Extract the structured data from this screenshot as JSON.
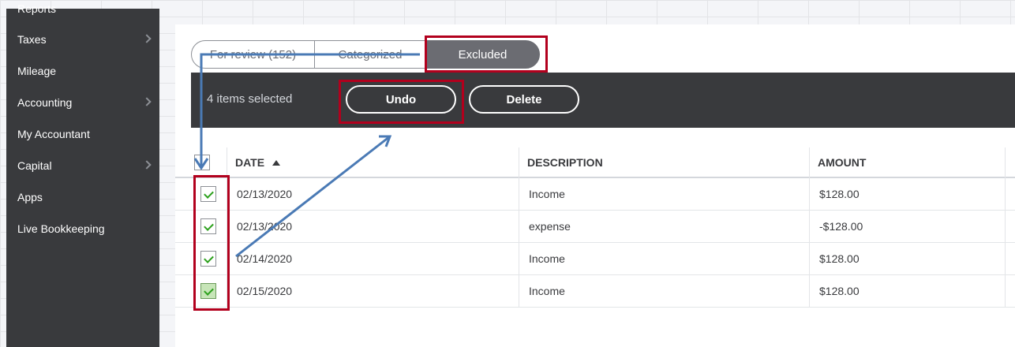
{
  "sidebar": {
    "items": [
      {
        "label": "Reports",
        "chevron": false
      },
      {
        "label": "Taxes",
        "chevron": true
      },
      {
        "label": "Mileage",
        "chevron": false
      },
      {
        "label": "Accounting",
        "chevron": true
      },
      {
        "label": "My Accountant",
        "chevron": false
      },
      {
        "label": "Capital",
        "chevron": true
      },
      {
        "label": "Apps",
        "chevron": false
      },
      {
        "label": "Live Bookkeeping",
        "chevron": false
      }
    ]
  },
  "tabs": [
    {
      "label": "For review (152)",
      "active": false
    },
    {
      "label": "Categorized",
      "active": false
    },
    {
      "label": "Excluded",
      "active": true
    }
  ],
  "action_bar": {
    "selected_text": "4 items selected",
    "undo_label": "Undo",
    "delete_label": "Delete"
  },
  "table": {
    "columns": [
      "DATE",
      "DESCRIPTION",
      "AMOUNT"
    ],
    "sorted_column": "DATE",
    "sort_direction": "ascending",
    "rows": [
      {
        "date": "02/13/2020",
        "description": "Income",
        "amount": "$128.00",
        "checked": true
      },
      {
        "date": "02/13/2020",
        "description": "expense",
        "amount": "-$128.00",
        "checked": true
      },
      {
        "date": "02/14/2020",
        "description": "Income",
        "amount": "$128.00",
        "checked": true
      },
      {
        "date": "02/15/2020",
        "description": "Income",
        "amount": "$128.00",
        "checked": true
      }
    ]
  },
  "annotation_colors": {
    "highlight_box": "#b2001d",
    "arrow": "#4a7ab5"
  }
}
